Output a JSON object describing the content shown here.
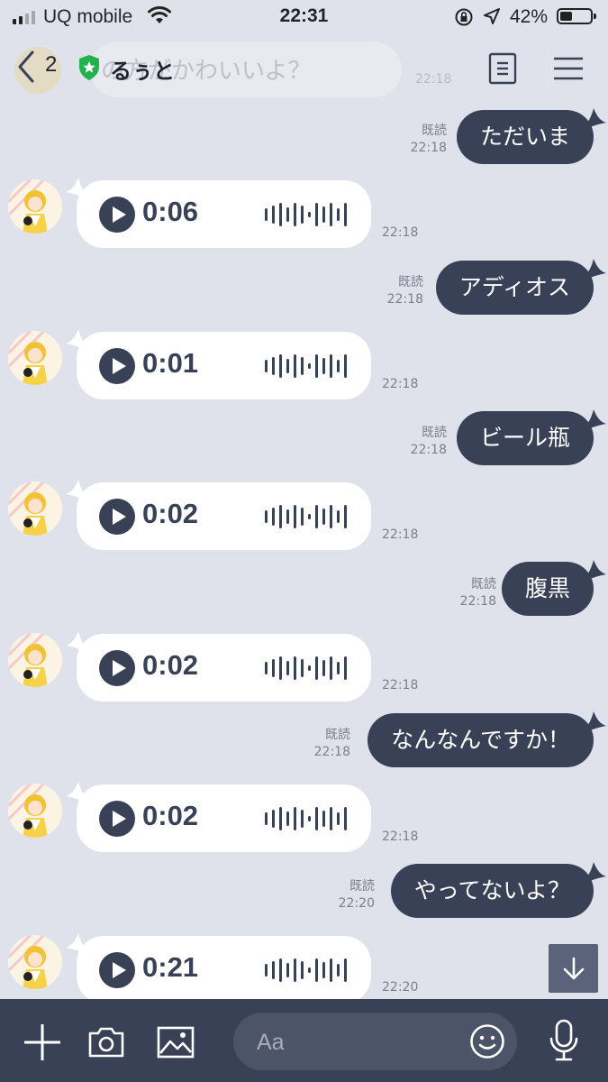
{
  "status_bar": {
    "carrier": "UQ mobile",
    "time": "22:31",
    "battery_percent": "42%",
    "battery_level": 0.42,
    "signal_bars": 2,
    "icons": [
      "signal-icon",
      "wifi-icon",
      "rotation-lock-icon",
      "location-arrow-icon",
      "battery-icon"
    ]
  },
  "header": {
    "back_count": "2",
    "title": "るぅと",
    "ghost_text": "の方がかわいいよ？",
    "ghost_time": "22:18",
    "icons": [
      "back-chevron-icon",
      "shield-star-icon",
      "notes-icon",
      "menu-icon"
    ]
  },
  "colors": {
    "background": "#dfe2ea",
    "bubble_out": "#394157",
    "bubble_in": "#ffffff",
    "bottom_bar": "#394157"
  },
  "messages": [
    {
      "type": "out",
      "text": "ただいま",
      "read": "既読",
      "time": "22:18"
    },
    {
      "type": "voice",
      "duration": "0:06",
      "time": "22:18"
    },
    {
      "type": "out",
      "text": "アディオス",
      "read": "既読",
      "time": "22:18"
    },
    {
      "type": "voice",
      "duration": "0:01",
      "time": "22:18"
    },
    {
      "type": "out",
      "text": "ビール瓶",
      "read": "既読",
      "time": "22:18"
    },
    {
      "type": "voice",
      "duration": "0:02",
      "time": "22:18"
    },
    {
      "type": "out",
      "text": "腹黒",
      "read": "既読",
      "time": "22:18"
    },
    {
      "type": "voice",
      "duration": "0:02",
      "time": "22:18"
    },
    {
      "type": "out",
      "text": "なんなんですか！",
      "read": "既読",
      "time": "22:18"
    },
    {
      "type": "voice",
      "duration": "0:02",
      "time": "22:18"
    },
    {
      "type": "out",
      "text": "やってないよ？",
      "read": "既読",
      "time": "22:20"
    },
    {
      "type": "voice",
      "duration": "0:21",
      "time": "22:20"
    }
  ],
  "bottom_bar": {
    "input_placeholder": "Aa",
    "icons": [
      "plus-icon",
      "camera-icon",
      "image-icon",
      "emoji-icon",
      "microphone-icon"
    ]
  }
}
